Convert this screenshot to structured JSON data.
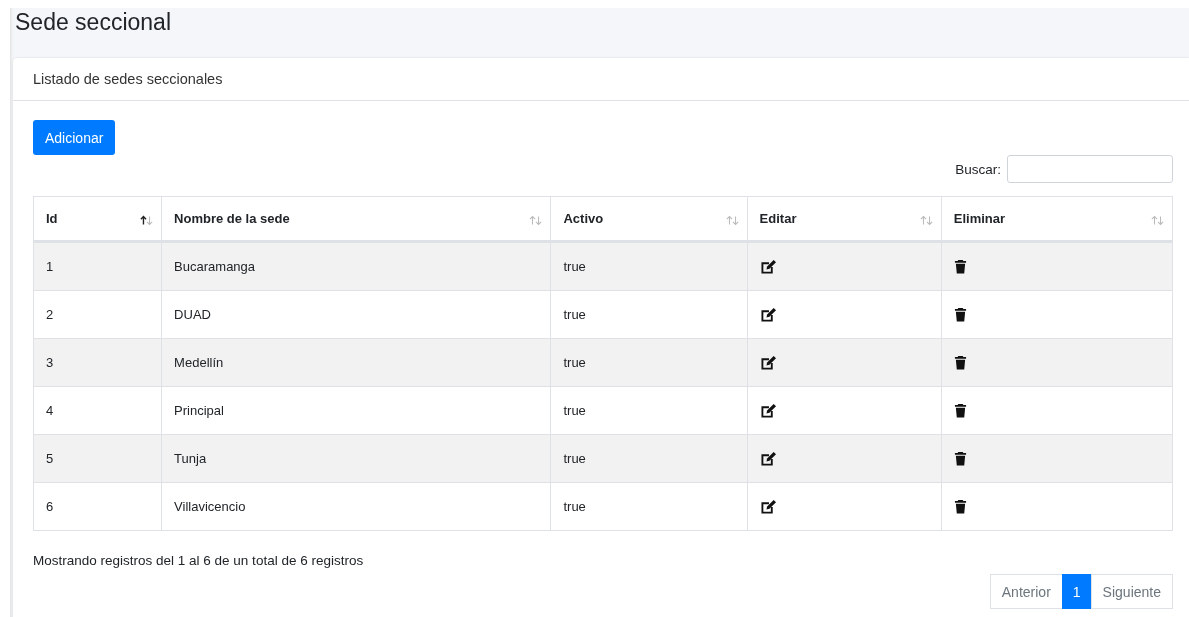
{
  "page": {
    "title": "Sede seccional"
  },
  "card": {
    "title": "Listado de sedes seccionales"
  },
  "add_button": "Adicionar",
  "search": {
    "label": "Buscar:"
  },
  "table": {
    "columns": [
      {
        "label": "Id",
        "sorted_ascending": true
      },
      {
        "label": "Nombre de la sede",
        "sorted_ascending": false
      },
      {
        "label": "Activo",
        "sorted_ascending": false
      },
      {
        "label": "Editar",
        "sorted_ascending": false
      },
      {
        "label": "Eliminar",
        "sorted_ascending": false
      }
    ],
    "rows": [
      {
        "id": "1",
        "name": "Bucaramanga",
        "active": "true"
      },
      {
        "id": "2",
        "name": "DUAD",
        "active": "true"
      },
      {
        "id": "3",
        "name": "Medellín",
        "active": "true"
      },
      {
        "id": "4",
        "name": "Principal",
        "active": "true"
      },
      {
        "id": "5",
        "name": "Tunja",
        "active": "true"
      },
      {
        "id": "6",
        "name": "Villavicencio",
        "active": "true"
      }
    ]
  },
  "info": "Mostrando registros del 1 al 6 de un total de 6 registros",
  "pagination": [
    {
      "label": "Anterior",
      "selected": false,
      "disabled": true
    },
    {
      "label": "1",
      "selected": true,
      "disabled": false
    },
    {
      "label": "Siguiente",
      "selected": false,
      "disabled": true
    }
  ]
}
